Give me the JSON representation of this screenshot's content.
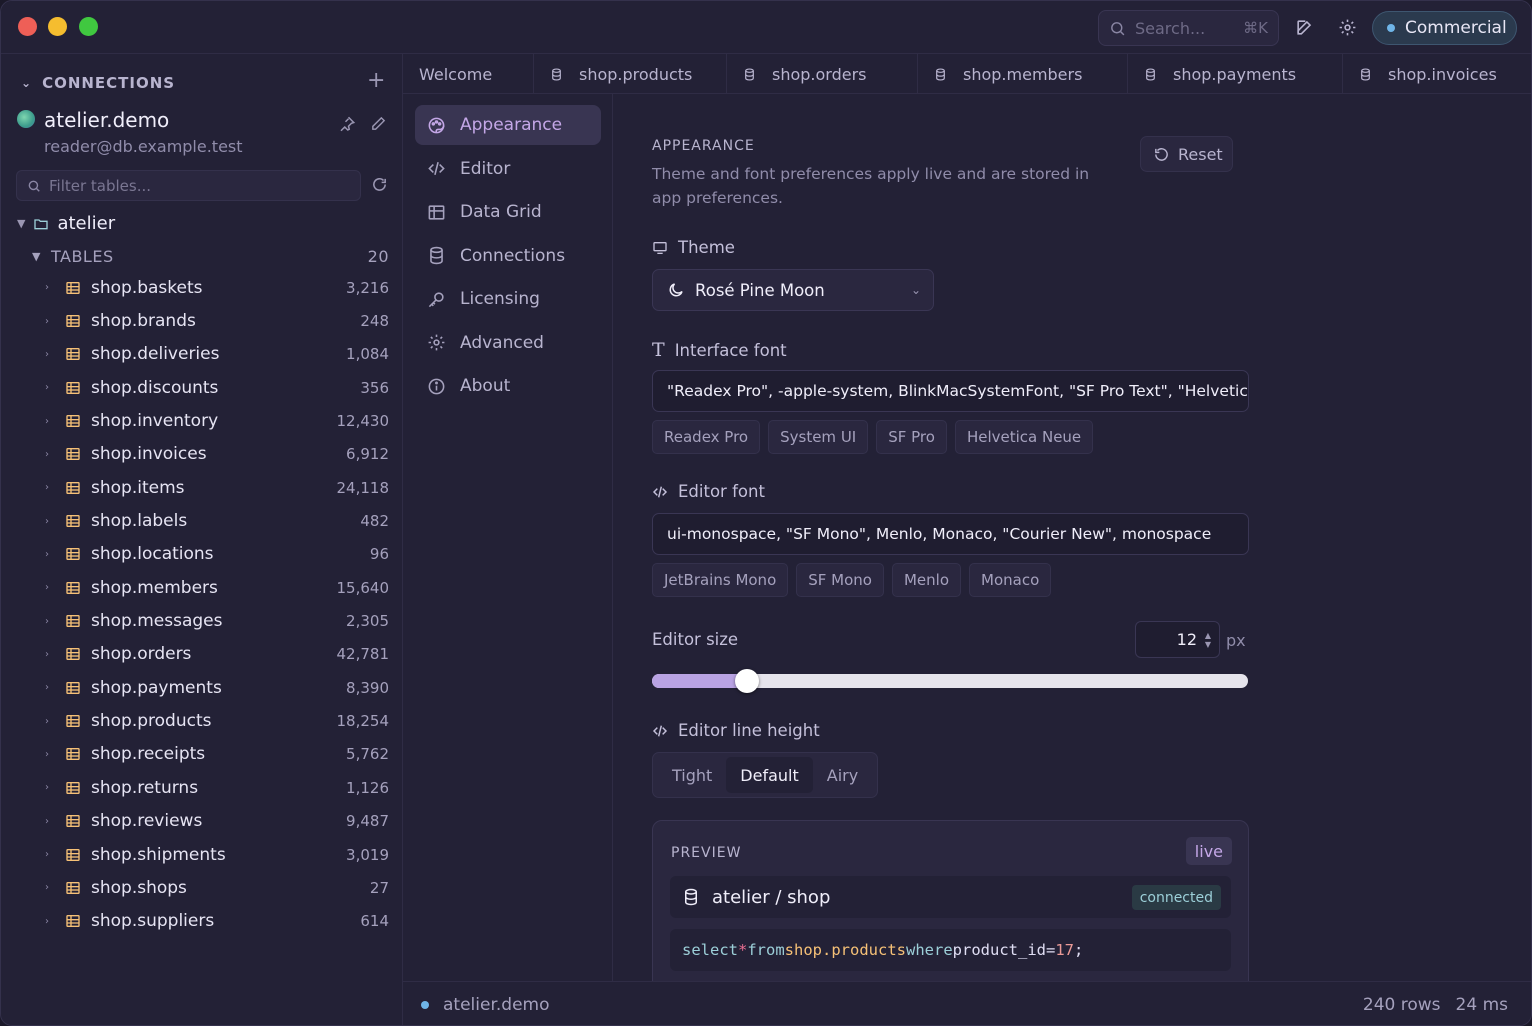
{
  "titlebar": {
    "search_placeholder": "Search...",
    "search_shortcut": "⌘K",
    "license_badge": "Commercial"
  },
  "sidebar": {
    "section_label": "CONNECTIONS",
    "connection": {
      "name": "atelier.demo",
      "user": "reader@db.example.test"
    },
    "filter_placeholder": "Filter tables...",
    "database": "atelier",
    "tables_label": "TABLES",
    "tables_count": "20",
    "tables": [
      {
        "name": "shop.baskets",
        "count": "3,216"
      },
      {
        "name": "shop.brands",
        "count": "248"
      },
      {
        "name": "shop.deliveries",
        "count": "1,084"
      },
      {
        "name": "shop.discounts",
        "count": "356"
      },
      {
        "name": "shop.inventory",
        "count": "12,430"
      },
      {
        "name": "shop.invoices",
        "count": "6,912"
      },
      {
        "name": "shop.items",
        "count": "24,118"
      },
      {
        "name": "shop.labels",
        "count": "482"
      },
      {
        "name": "shop.locations",
        "count": "96"
      },
      {
        "name": "shop.members",
        "count": "15,640"
      },
      {
        "name": "shop.messages",
        "count": "2,305"
      },
      {
        "name": "shop.orders",
        "count": "42,781"
      },
      {
        "name": "shop.payments",
        "count": "8,390"
      },
      {
        "name": "shop.products",
        "count": "18,254"
      },
      {
        "name": "shop.receipts",
        "count": "5,762"
      },
      {
        "name": "shop.returns",
        "count": "1,126"
      },
      {
        "name": "shop.reviews",
        "count": "9,487"
      },
      {
        "name": "shop.shipments",
        "count": "3,019"
      },
      {
        "name": "shop.shops",
        "count": "27"
      },
      {
        "name": "shop.suppliers",
        "count": "614"
      }
    ]
  },
  "tabs": [
    "Welcome",
    "shop.products",
    "shop.orders",
    "shop.members",
    "shop.payments",
    "shop.invoices"
  ],
  "settings_nav": [
    "Appearance",
    "Editor",
    "Data Grid",
    "Connections",
    "Licensing",
    "Advanced",
    "About"
  ],
  "appearance": {
    "title": "APPEARANCE",
    "description": "Theme and font preferences apply live and are stored in app preferences.",
    "reset_label": "Reset",
    "theme_label": "Theme",
    "theme_value": "Rosé Pine Moon",
    "interface_font_label": "Interface font",
    "interface_font_value": "\"Readex Pro\", -apple-system, BlinkMacSystemFont, \"SF Pro Text\", \"Helvetica",
    "interface_font_presets": [
      "Readex Pro",
      "System UI",
      "SF Pro",
      "Helvetica Neue"
    ],
    "editor_font_label": "Editor font",
    "editor_font_value": "ui-monospace, \"SF Mono\", Menlo, Monaco, \"Courier New\", monospace",
    "editor_font_presets": [
      "JetBrains Mono",
      "SF Mono",
      "Menlo",
      "Monaco"
    ],
    "editor_size_label": "Editor size",
    "editor_size_value": "12",
    "editor_size_unit": "px",
    "editor_size_fraction": 0.16,
    "line_height_label": "Editor line height",
    "line_height_options": [
      "Tight",
      "Default",
      "Airy"
    ],
    "line_height_selected": "Default",
    "preview": {
      "title": "PREVIEW",
      "live_badge": "live",
      "connection_path": "atelier / shop",
      "status": "connected",
      "code": {
        "kw_select": "select",
        "star": "*",
        "kw_from": "from",
        "table": "shop.products",
        "kw_where": "where",
        "column": "product_id",
        "eq": "=",
        "value": "17",
        "semi": ";"
      }
    }
  },
  "statusbar": {
    "connection": "atelier.demo",
    "rows": "240 rows",
    "time": "24 ms"
  },
  "colors": {
    "accent": "#c4a7e7",
    "table_icon": "#f6c177",
    "status_dot": "#6fb5e8"
  }
}
